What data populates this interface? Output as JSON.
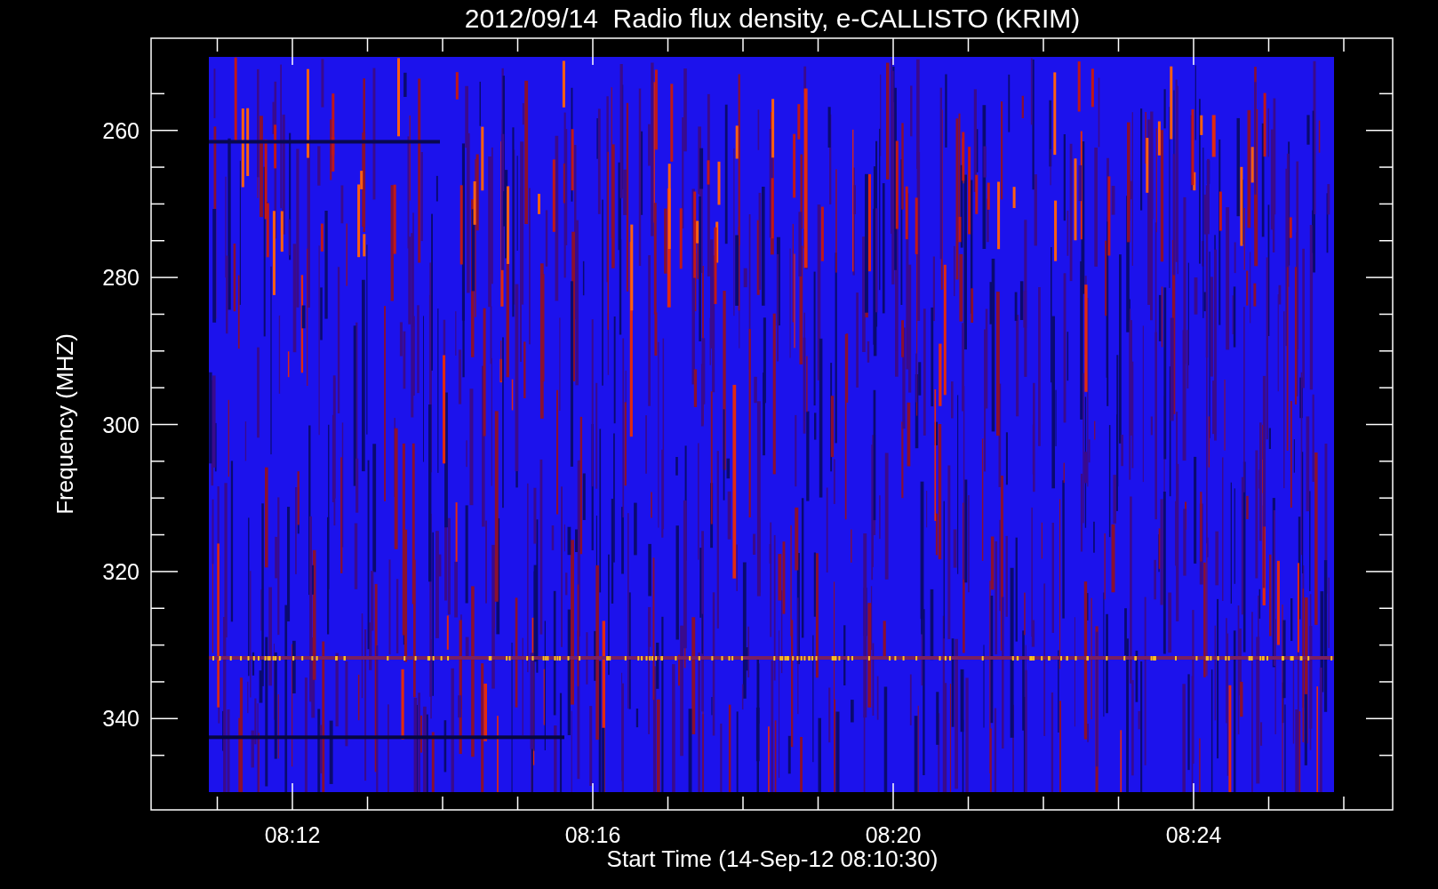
{
  "chart": {
    "title": "2012/09/14  Radio flux density, e-CALLISTO (KRIM)",
    "y_axis": {
      "label": "Frequency (MHZ)",
      "ticks": [
        "260",
        "280",
        "300",
        "320",
        "340"
      ]
    },
    "x_axis": {
      "label": "Start Time (14-Sep-12 08:10:30)",
      "ticks": [
        "08:12",
        "08:16",
        "08:20",
        "08:24"
      ]
    }
  }
}
